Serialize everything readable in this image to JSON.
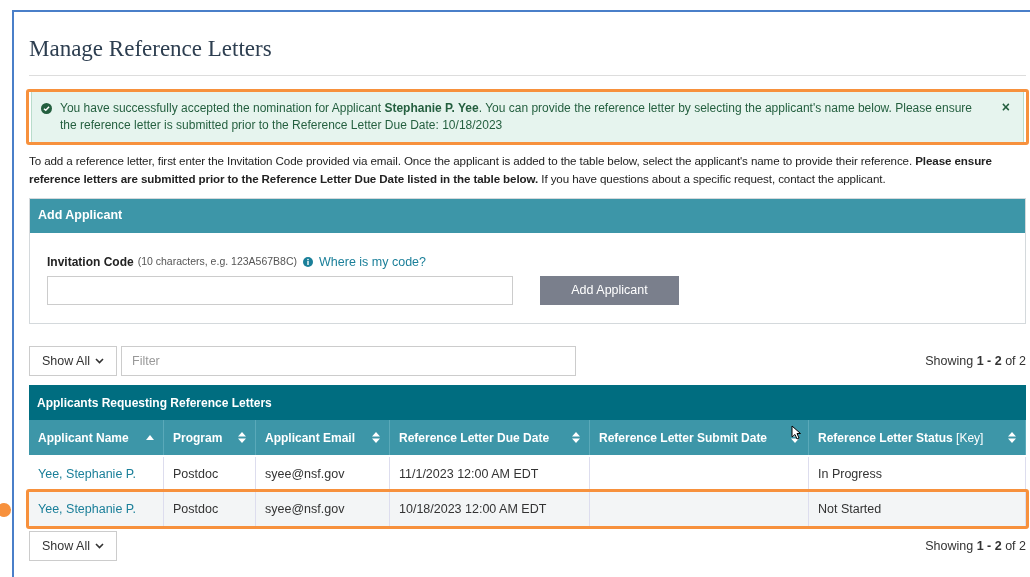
{
  "page": {
    "title": "Manage Reference Letters"
  },
  "alert": {
    "kind": "success",
    "highlighted": true,
    "message": "You have successfully accepted the nomination for Applicant **Stephanie P. Yee**. You can provide the reference letter by selecting the applicant's name below. Please ensure the reference letter is submitted prior to the Reference Letter Due Date: 10/18/2023",
    "close": "×"
  },
  "intro": "To add a reference letter, first enter the Invitation Code provided via email. Once the applicant is added to the table below, select the applicant's name to provide their reference. **Please ensure reference letters are submitted prior to the Reference Letter Due Date listed in the table below.** If you have questions about a specific request, contact the applicant.",
  "add_applicant": {
    "title": "Add Applicant",
    "field_label": "Invitation Code",
    "field_hint": "(10 characters, e.g. 123A567B8C)",
    "help_link": "Where is my code?",
    "button": "Add Applicant"
  },
  "toolbar": {
    "page_size": "Show All",
    "filter_placeholder": "Filter",
    "showing": "Showing **1 - 2** of 2"
  },
  "table": {
    "title": "Applicants Requesting Reference Letters",
    "columns": [
      {
        "label": "Applicant Name",
        "sorted": true
      },
      {
        "label": "Program",
        "sorted": false
      },
      {
        "label": "Applicant Email",
        "sorted": false
      },
      {
        "label": "Reference Letter Due Date",
        "sorted": false
      },
      {
        "label": "Reference Letter Submit Date",
        "sorted": false
      },
      {
        "label": "Reference Letter Status",
        "key_link": "[Key]",
        "sorted": false
      }
    ],
    "rows": [
      {
        "highlighted": false,
        "cells": [
          "Yee, Stephanie P.",
          "Postdoc",
          "syee@nsf.gov",
          "11/1/2023 12:00 AM EDT",
          "In Progress"
        ]
      },
      {
        "highlighted": true,
        "cells": [
          "Yee, Stephanie P.",
          "Postdoc",
          "syee@nsf.gov",
          "10/18/2023 12:00 AM EDT",
          "Not Started"
        ]
      }
    ]
  },
  "footer": {
    "page_size": "Show All",
    "showing": "Showing **1 - 2** of 2"
  }
}
